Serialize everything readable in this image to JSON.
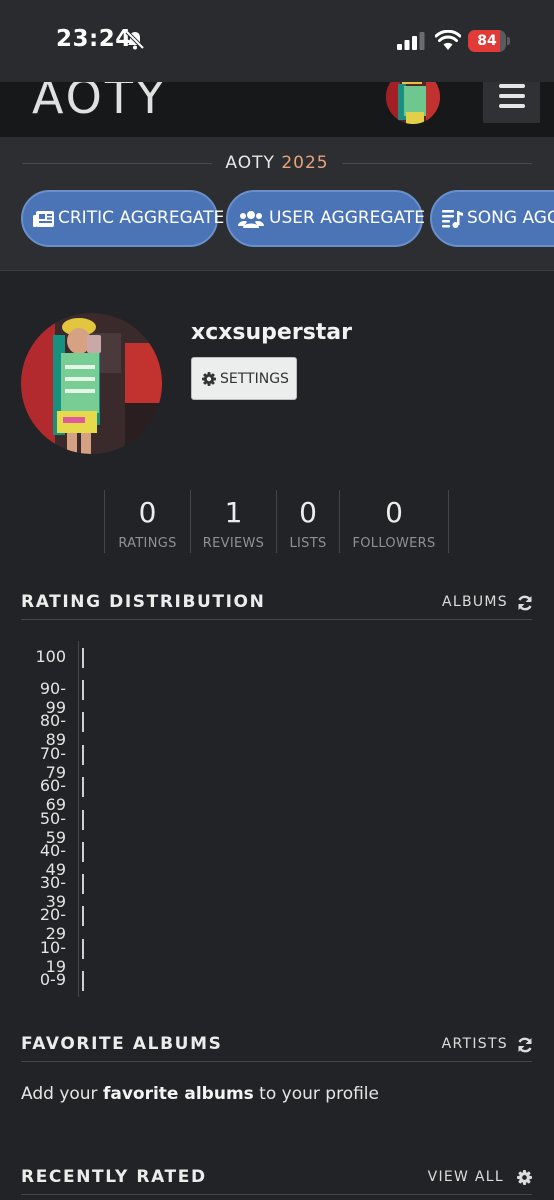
{
  "status_bar": {
    "time": "23:24",
    "battery": "84"
  },
  "nav": {
    "logo": "AOTY"
  },
  "aggregate": {
    "title_prefix": "AOTY",
    "title_year": "2025",
    "buttons": [
      "CRITIC AGGREGATE",
      "USER AGGREGATE",
      "SONG AGGREGATE"
    ]
  },
  "profile": {
    "username": "xcxsuperstar",
    "settings_label": "SETTINGS"
  },
  "stats": [
    {
      "value": "0",
      "label": "RATINGS"
    },
    {
      "value": "1",
      "label": "REVIEWS"
    },
    {
      "value": "0",
      "label": "LISTS"
    },
    {
      "value": "0",
      "label": "FOLLOWERS"
    }
  ],
  "rating_distribution": {
    "title": "RATING DISTRIBUTION",
    "toggle_label": "ALBUMS",
    "buckets": [
      "100",
      "90-99",
      "80-89",
      "70-79",
      "60-69",
      "50-59",
      "40-49",
      "30-39",
      "20-29",
      "10-19",
      "0-9"
    ],
    "counts": [
      0,
      0,
      0,
      0,
      0,
      0,
      0,
      0,
      0,
      0,
      0
    ]
  },
  "favorite_albums": {
    "title": "FAVORITE ALBUMS",
    "toggle_label": "ARTISTS",
    "message_pre": "Add your ",
    "message_bold": "favorite albums",
    "message_post": " to your profile"
  },
  "recently_rated": {
    "title": "RECENTLY RATED",
    "link_label": "VIEW ALL"
  },
  "colors": {
    "background": "#222326",
    "pill_blue": "#4a74b6",
    "year_accent": "#e8a37a",
    "battery_red": "#e23a37"
  }
}
